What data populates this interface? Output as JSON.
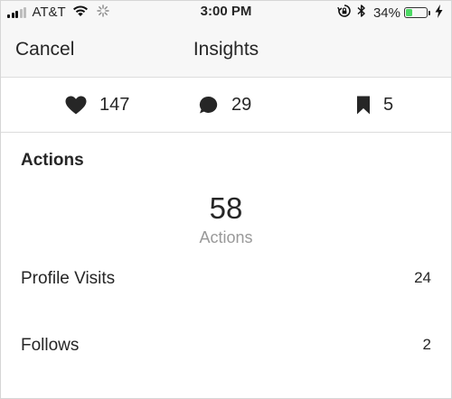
{
  "status_bar": {
    "carrier": "AT&T",
    "time": "3:00 PM",
    "battery_percent": "34%",
    "battery_level": 0.34,
    "icons": [
      "signal-icon",
      "wifi-icon",
      "activity-spinner-icon",
      "rotation-lock-icon",
      "bluetooth-icon",
      "battery-icon",
      "charging-bolt-icon"
    ]
  },
  "nav": {
    "cancel_label": "Cancel",
    "title": "Insights"
  },
  "stats": {
    "likes": "147",
    "comments": "29",
    "saves": "5",
    "icons": [
      "heart-icon",
      "comment-bubble-icon",
      "bookmark-icon"
    ]
  },
  "actions": {
    "section_title": "Actions",
    "total": "58",
    "total_label": "Actions",
    "rows": [
      {
        "label": "Profile Visits",
        "value": "24"
      },
      {
        "label": "Follows",
        "value": "2"
      }
    ]
  },
  "colors": {
    "text": "#262626",
    "muted": "#999999",
    "bar_background": "#f7f7f7",
    "battery_green": "#4cd964"
  }
}
